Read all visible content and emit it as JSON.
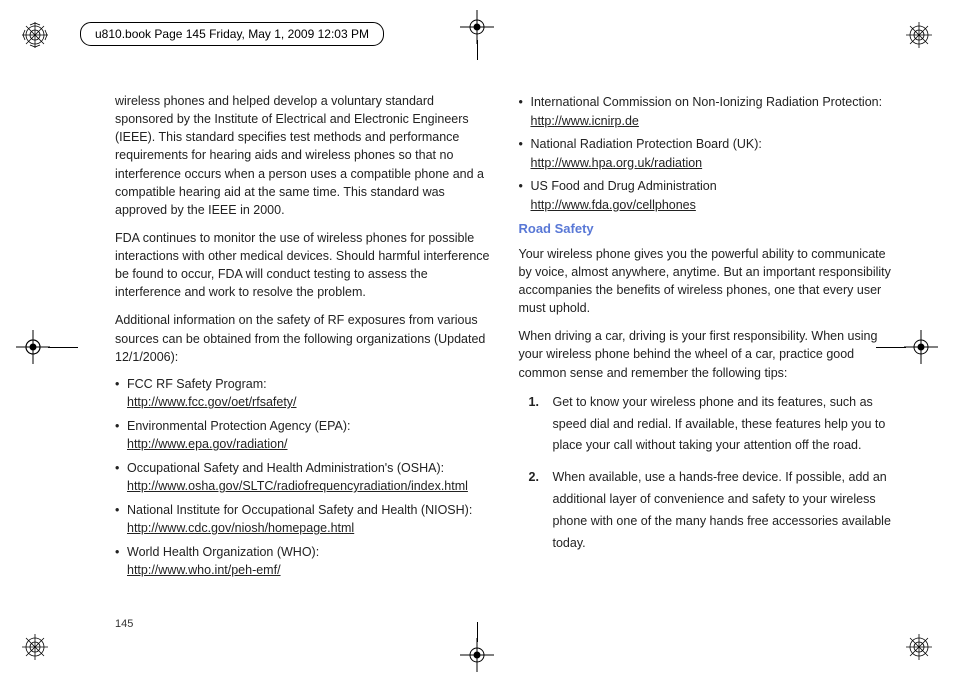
{
  "header": {
    "text": "u810.book  Page 145  Friday, May 1, 2009  12:03 PM"
  },
  "page_number": "145",
  "left": {
    "p1": "wireless phones and helped develop a voluntary standard sponsored by the Institute of Electrical and Electronic Engineers (IEEE). This standard specifies test methods and performance requirements for hearing aids and wireless phones so that no interference occurs when a person uses a compatible phone and a compatible hearing aid at the same time. This standard was approved by the IEEE in 2000.",
    "p2": "FDA continues to monitor the use of wireless phones for possible interactions with other medical devices. Should harmful interference be found to occur, FDA will conduct testing to assess the interference and work to resolve the problem.",
    "p3": "Additional information on the safety of RF exposures from various sources can be obtained from the following organizations (Updated 12/1/2006):",
    "items": [
      {
        "label": "FCC RF Safety Program:",
        "url": "http://www.fcc.gov/oet/rfsafety/"
      },
      {
        "label": "Environmental Protection Agency (EPA):",
        "url": "http://www.epa.gov/radiation/"
      },
      {
        "label": "Occupational Safety and Health Administration's (OSHA):",
        "url": "http://www.osha.gov/SLTC/radiofrequencyradiation/index.html"
      },
      {
        "label": "National Institute for Occupational Safety and Health (NIOSH):",
        "url": "http://www.cdc.gov/niosh/homepage.html"
      },
      {
        "label": "World Health Organization (WHO):",
        "url": "http://www.who.int/peh-emf/"
      }
    ]
  },
  "right": {
    "items_top": [
      {
        "label": "International Commission on Non-Ionizing Radiation Protection:",
        "url": "http://www.icnirp.de"
      },
      {
        "label": "National Radiation Protection Board (UK):",
        "url": "http://www.hpa.org.uk/radiation"
      },
      {
        "label": "US Food and Drug Administration",
        "url": "http://www.fda.gov/cellphones"
      }
    ],
    "heading": "Road Safety",
    "p1": "Your wireless phone gives you the powerful ability to communicate by voice, almost anywhere, anytime. But an important responsibility accompanies the benefits of wireless phones, one that every user must uphold.",
    "p2": "When driving a car, driving is your first responsibility. When using your wireless phone behind the wheel of a car, practice good common sense and remember the following tips:",
    "numbered": [
      {
        "n": "1.",
        "text": "Get to know your wireless phone and its features, such as speed dial and redial. If available, these features help you to place your call without taking your attention off the road."
      },
      {
        "n": "2.",
        "text": "When available, use a hands-free device. If possible, add an additional layer of convenience and safety to your wireless phone with one of the many hands free accessories available today."
      }
    ]
  }
}
